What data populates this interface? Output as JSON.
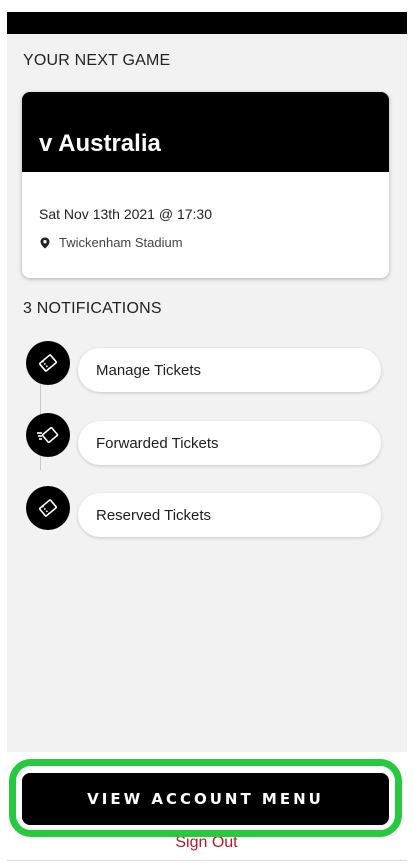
{
  "next_game": {
    "section_title": "YOUR NEXT GAME",
    "opponent": "v Australia",
    "datetime": "Sat Nov 13th 2021 @ 17:30",
    "venue": "Twickenham Stadium"
  },
  "notifications": {
    "section_title": "3 NOTIFICATIONS",
    "items": [
      {
        "label": "Manage Tickets",
        "icon": "ticket-icon"
      },
      {
        "label": "Forwarded Tickets",
        "icon": "forward-ticket-icon"
      },
      {
        "label": "Reserved Tickets",
        "icon": "ticket-icon"
      }
    ]
  },
  "footer": {
    "account_menu_label": "VIEW ACCOUNT MENU",
    "sign_out_label": "Sign Out"
  },
  "colors": {
    "highlight": "#27c93f",
    "sign_out": "#b01c2e"
  }
}
